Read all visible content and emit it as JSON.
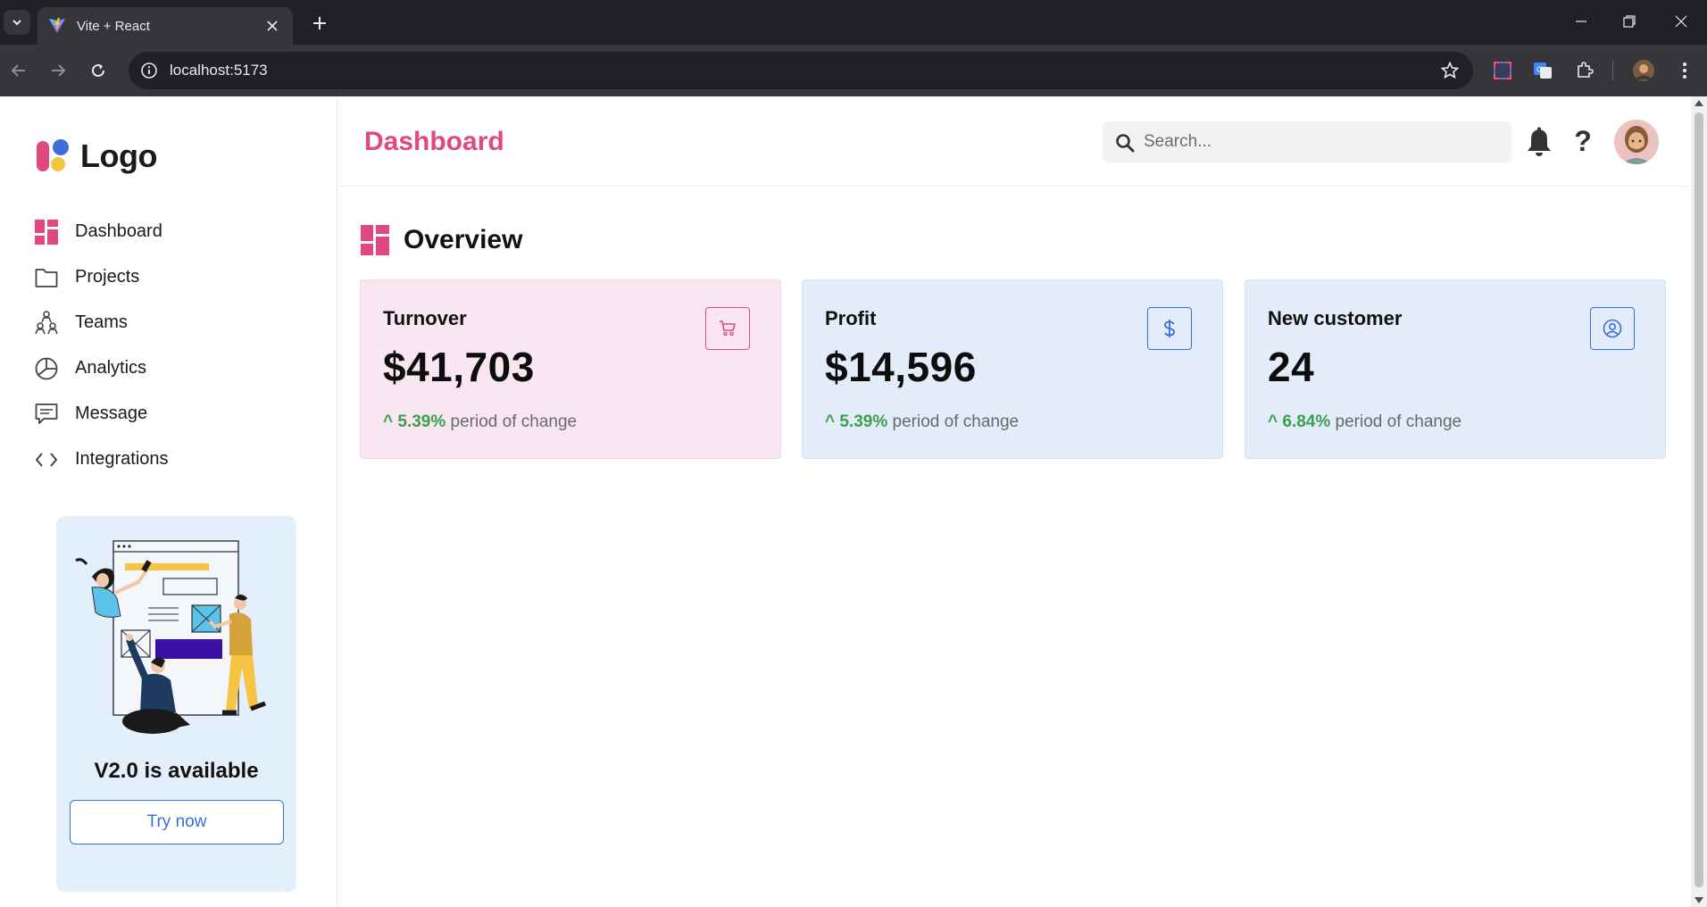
{
  "browser": {
    "tab_title": "Vite + React",
    "url": "localhost:5173"
  },
  "sidebar": {
    "logo_text": "Logo",
    "items": [
      {
        "label": "Dashboard",
        "icon": "dashboard-icon"
      },
      {
        "label": "Projects",
        "icon": "folder-icon"
      },
      {
        "label": "Teams",
        "icon": "teams-icon"
      },
      {
        "label": "Analytics",
        "icon": "pie-chart-icon"
      },
      {
        "label": "Message",
        "icon": "message-icon"
      },
      {
        "label": "Integrations",
        "icon": "code-icon"
      }
    ],
    "promo": {
      "title": "V2.0 is available",
      "button_label": "Try now"
    }
  },
  "header": {
    "title": "Dashboard",
    "search_placeholder": "Search...",
    "help_label": "?"
  },
  "overview": {
    "title": "Overview",
    "cards": [
      {
        "label": "Turnover",
        "value": "$41,703",
        "change_prefix": "^ ",
        "change_pct": "5.39%",
        "change_suffix": " period of change",
        "icon": "cart-icon"
      },
      {
        "label": "Profit",
        "value": "$14,596",
        "change_prefix": "^ ",
        "change_pct": "5.39%",
        "change_suffix": " period of change",
        "icon": "dollar-icon"
      },
      {
        "label": "New customer",
        "value": "24",
        "change_prefix": "^ ",
        "change_pct": "6.84%",
        "change_suffix": " period of change",
        "icon": "user-circle-icon"
      }
    ]
  },
  "colors": {
    "accent_pink": "#e0487f",
    "accent_blue": "#3b6fd8",
    "positive_green": "#3aa04b",
    "card_pink_bg": "#f9e6f0",
    "card_blue_bg": "#e2ecfb"
  }
}
